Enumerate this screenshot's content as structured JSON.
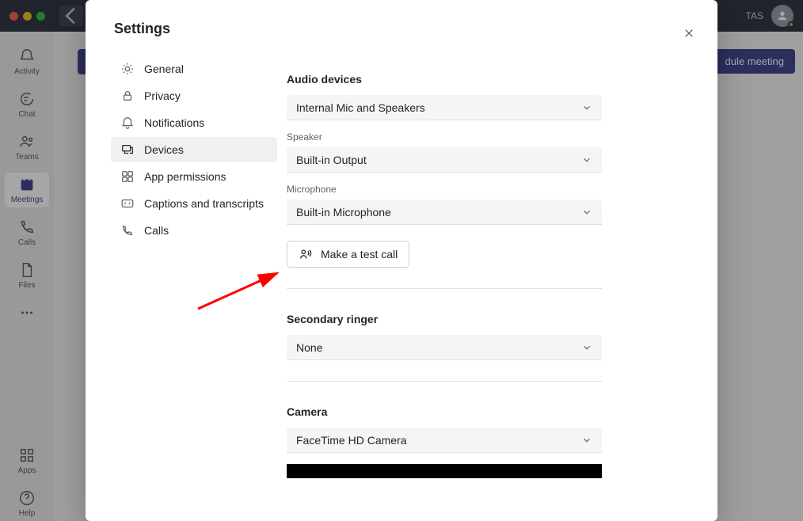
{
  "titlebar": {
    "account_label": "TAS"
  },
  "rail": {
    "activity": "Activity",
    "chat": "Chat",
    "teams": "Teams",
    "meetings": "Meetings",
    "calls": "Calls",
    "files": "Files",
    "apps": "Apps",
    "help": "Help"
  },
  "main": {
    "schedule_button": "dule meeting"
  },
  "settings": {
    "title": "Settings",
    "nav": {
      "general": "General",
      "privacy": "Privacy",
      "notifications": "Notifications",
      "devices": "Devices",
      "app_permissions": "App permissions",
      "captions": "Captions and transcripts",
      "calls": "Calls"
    },
    "devices_panel": {
      "audio_devices_title": "Audio devices",
      "audio_devices_value": "Internal Mic and Speakers",
      "speaker_label": "Speaker",
      "speaker_value": "Built-in Output",
      "microphone_label": "Microphone",
      "microphone_value": "Built-in Microphone",
      "test_call_button": "Make a test call",
      "secondary_ringer_title": "Secondary ringer",
      "secondary_ringer_value": "None",
      "camera_title": "Camera",
      "camera_value": "FaceTime HD Camera"
    }
  }
}
